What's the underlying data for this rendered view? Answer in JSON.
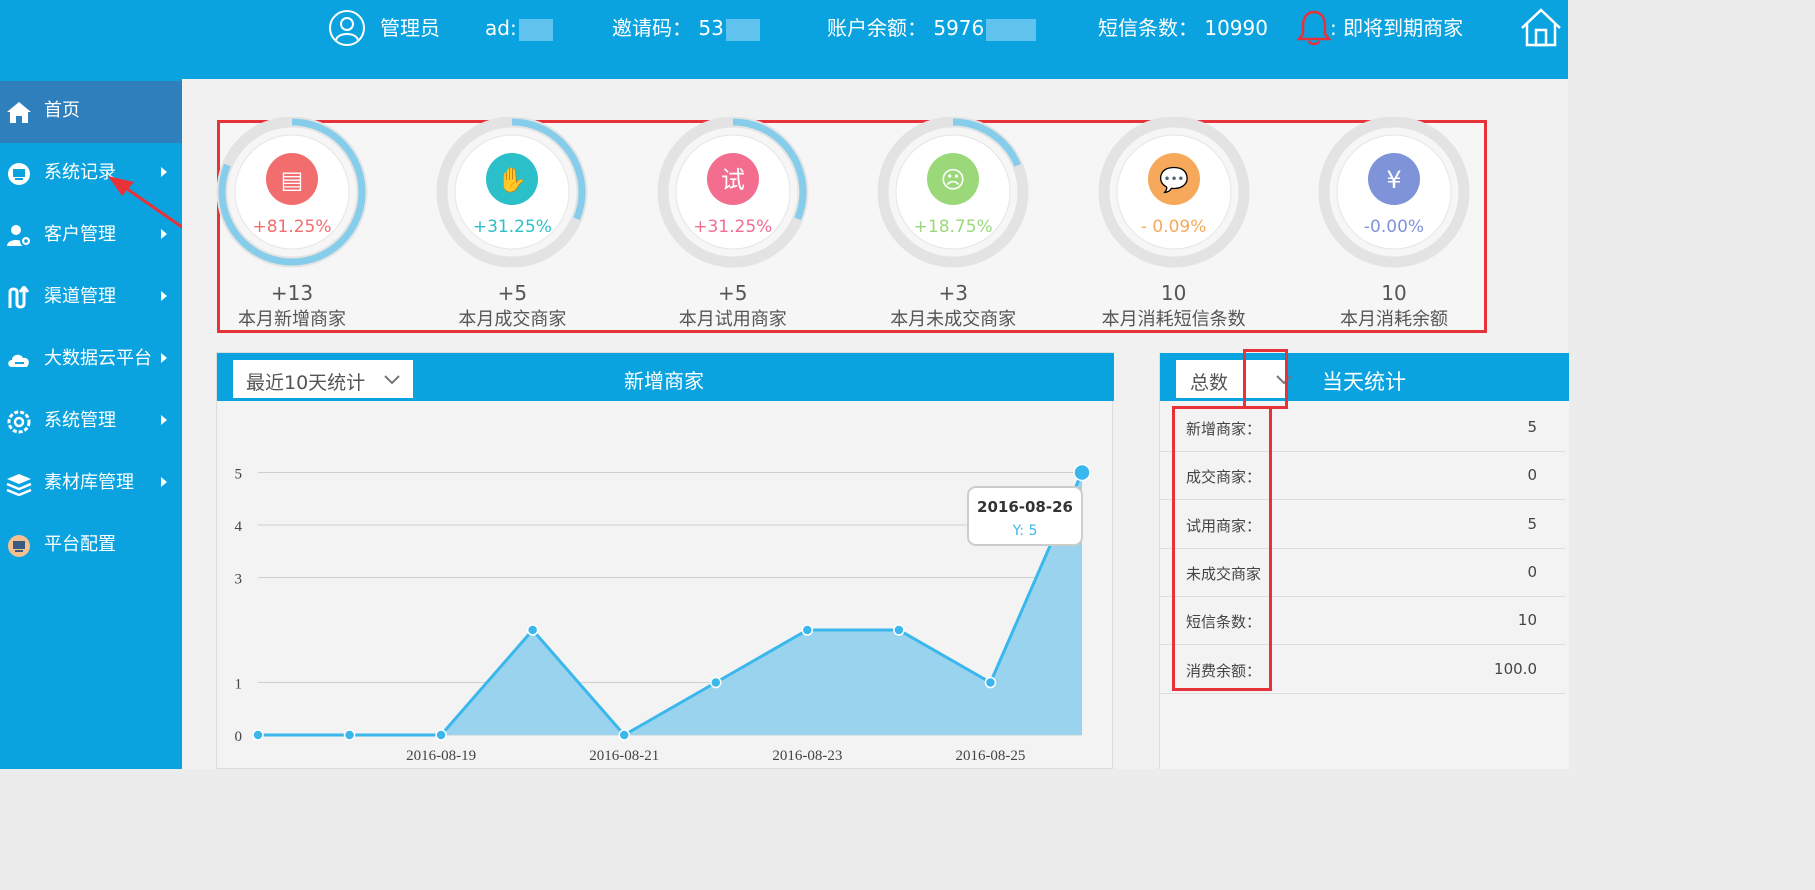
{
  "header": {
    "role": "管理员",
    "account": "ad:",
    "invite_label": "邀请码：",
    "invite_value": "53",
    "balance_label": "账户余额：",
    "balance_value": "5976",
    "sms_label": "短信条数：",
    "sms_value": "10990",
    "expiring_label": ": 即将到期商家"
  },
  "sidebar": {
    "items": [
      {
        "label": "首页",
        "icon": "home-icon"
      },
      {
        "label": "系统记录",
        "icon": "monitor-icon"
      },
      {
        "label": "客户管理",
        "icon": "user-gear-icon"
      },
      {
        "label": "渠道管理",
        "icon": "channel-icon"
      },
      {
        "label": "大数据云平台",
        "icon": "cloud-icon"
      },
      {
        "label": "系统管理",
        "icon": "gear-icon"
      },
      {
        "label": "素材库管理",
        "icon": "layers-icon"
      },
      {
        "label": "平台配置",
        "icon": "platform-icon"
      }
    ]
  },
  "stats": [
    {
      "pct": "+81.25%",
      "num": "+13",
      "label": "本月新增商家",
      "color": "#f26d6d",
      "progress": 0.8125,
      "icon": "store-icon",
      "glyph": "▤"
    },
    {
      "pct": "+31.25%",
      "num": "+5",
      "label": "本月成交商家",
      "color": "#2bc0c9",
      "progress": 0.3125,
      "icon": "handshake-icon",
      "glyph": "✋"
    },
    {
      "pct": "+31.25%",
      "num": "+5",
      "label": "本月试用商家",
      "color": "#f26d8e",
      "progress": 0.3125,
      "icon": "trial-icon",
      "glyph": "试"
    },
    {
      "pct": "+18.75%",
      "num": "+3",
      "label": "本月未成交商家",
      "color": "#9ad87a",
      "progress": 0.1875,
      "icon": "sad-face-icon",
      "glyph": "☹"
    },
    {
      "pct": "- 0.09%",
      "num": "10",
      "label": "本月消耗短信条数",
      "color": "#f6a85b",
      "progress": 0,
      "icon": "sms-bubble-icon",
      "glyph": "💬"
    },
    {
      "pct": "-0.00%",
      "num": "10",
      "label": "本月消耗余额",
      "color": "#7f93d8",
      "progress": 0,
      "icon": "yen-icon",
      "glyph": "¥"
    }
  ],
  "chart_panel": {
    "select_value": "最近10天统计",
    "title": "新增商家"
  },
  "chart_data": {
    "type": "area",
    "x": [
      "2016-08-17",
      "2016-08-18",
      "2016-08-19",
      "2016-08-20",
      "2016-08-21",
      "2016-08-22",
      "2016-08-23",
      "2016-08-24",
      "2016-08-25",
      "2016-08-26"
    ],
    "x_tick_labels": [
      "2016-08-19",
      "2016-08-21",
      "2016-08-23",
      "2016-08-25"
    ],
    "y_tick_labels": [
      "0",
      "1",
      "3",
      "4",
      "5"
    ],
    "values": [
      0,
      0,
      0,
      2,
      0,
      1,
      2,
      2,
      1,
      5
    ],
    "tooltip": {
      "date": "2016-08-26",
      "value_text": "Y: 5"
    },
    "ylim": [
      0,
      5
    ],
    "grid": true,
    "line_color": "#3ab7ec",
    "fill_color": "#9ad3ee"
  },
  "today_panel": {
    "select_value": "总数",
    "title": "当天统计",
    "rows": [
      {
        "k": "新增商家：",
        "v": "5"
      },
      {
        "k": "成交商家：",
        "v": "0"
      },
      {
        "k": "试用商家：",
        "v": "5"
      },
      {
        "k": "未成交商家",
        "v": "0"
      },
      {
        "k": "短信条数：",
        "v": "10"
      },
      {
        "k": "消费余额：",
        "v": "100.0"
      }
    ]
  }
}
